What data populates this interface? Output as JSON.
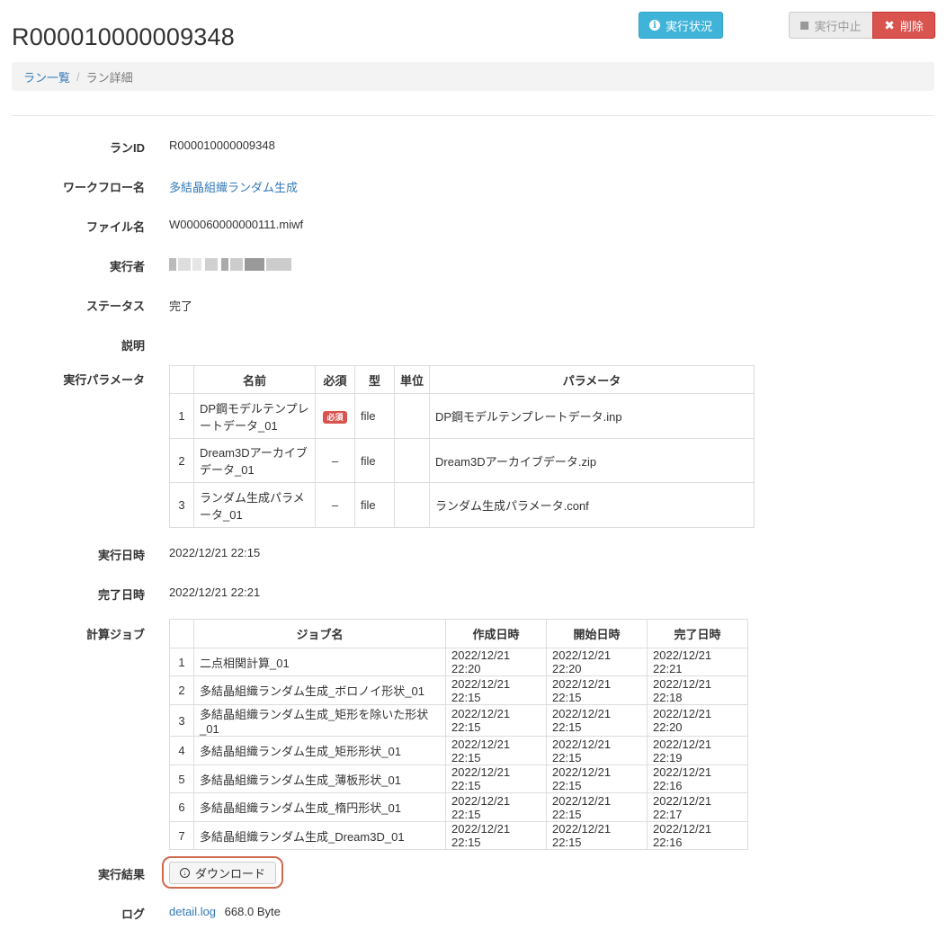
{
  "header": {
    "title": "R000010000009348",
    "status_button": "実行状況",
    "stop_button": "実行中止",
    "delete_button": "削除"
  },
  "breadcrumb": {
    "home": "ラン一覧",
    "current": "ラン詳細"
  },
  "fields": {
    "run_id_label": "ランID",
    "run_id": "R000010000009348",
    "workflow_label": "ワークフロー名",
    "workflow": "多結晶組織ランダム生成",
    "file_label": "ファイル名",
    "file": "W000060000000111.miwf",
    "executor_label": "実行者",
    "status_label": "ステータス",
    "status": "完了",
    "description_label": "説明",
    "params_label": "実行パラメータ",
    "exec_date_label": "実行日時",
    "exec_date": "2022/12/21 22:15",
    "done_date_label": "完了日時",
    "done_date": "2022/12/21 22:21",
    "jobs_label": "計算ジョブ",
    "result_label": "実行結果",
    "download_button": "ダウンロード",
    "log_label": "ログ",
    "log_link": "detail.log",
    "log_size": "668.0 Byte"
  },
  "params_table": {
    "headers": [
      "",
      "名前",
      "必須",
      "型",
      "単位",
      "パラメータ"
    ],
    "rows": [
      {
        "no": "1",
        "name": "DP鋼モデルテンプレートデータ_01",
        "required": "必須",
        "type": "file",
        "unit": "",
        "value": "DP鋼モデルテンプレートデータ.inp"
      },
      {
        "no": "2",
        "name": "Dream3Dアーカイブデータ_01",
        "required": "–",
        "type": "file",
        "unit": "",
        "value": "Dream3Dアーカイブデータ.zip"
      },
      {
        "no": "3",
        "name": "ランダム生成パラメータ_01",
        "required": "–",
        "type": "file",
        "unit": "",
        "value": "ランダム生成パラメータ.conf"
      }
    ]
  },
  "jobs_table": {
    "headers": [
      "",
      "ジョブ名",
      "作成日時",
      "開始日時",
      "完了日時"
    ],
    "rows": [
      {
        "no": "1",
        "name": "二点相関計算_01",
        "created": "2022/12/21 22:20",
        "started": "2022/12/21 22:20",
        "finished": "2022/12/21 22:21"
      },
      {
        "no": "2",
        "name": "多結晶組織ランダム生成_ボロノイ形状_01",
        "created": "2022/12/21 22:15",
        "started": "2022/12/21 22:15",
        "finished": "2022/12/21 22:18"
      },
      {
        "no": "3",
        "name": "多結晶組織ランダム生成_矩形を除いた形状_01",
        "created": "2022/12/21 22:15",
        "started": "2022/12/21 22:15",
        "finished": "2022/12/21 22:20"
      },
      {
        "no": "4",
        "name": "多結晶組織ランダム生成_矩形形状_01",
        "created": "2022/12/21 22:15",
        "started": "2022/12/21 22:15",
        "finished": "2022/12/21 22:19"
      },
      {
        "no": "5",
        "name": "多結晶組織ランダム生成_薄板形状_01",
        "created": "2022/12/21 22:15",
        "started": "2022/12/21 22:15",
        "finished": "2022/12/21 22:16"
      },
      {
        "no": "6",
        "name": "多結晶組織ランダム生成_楕円形状_01",
        "created": "2022/12/21 22:15",
        "started": "2022/12/21 22:15",
        "finished": "2022/12/21 22:17"
      },
      {
        "no": "7",
        "name": "多結晶組織ランダム生成_Dream3D_01",
        "created": "2022/12/21 22:15",
        "started": "2022/12/21 22:15",
        "finished": "2022/12/21 22:16"
      }
    ]
  }
}
